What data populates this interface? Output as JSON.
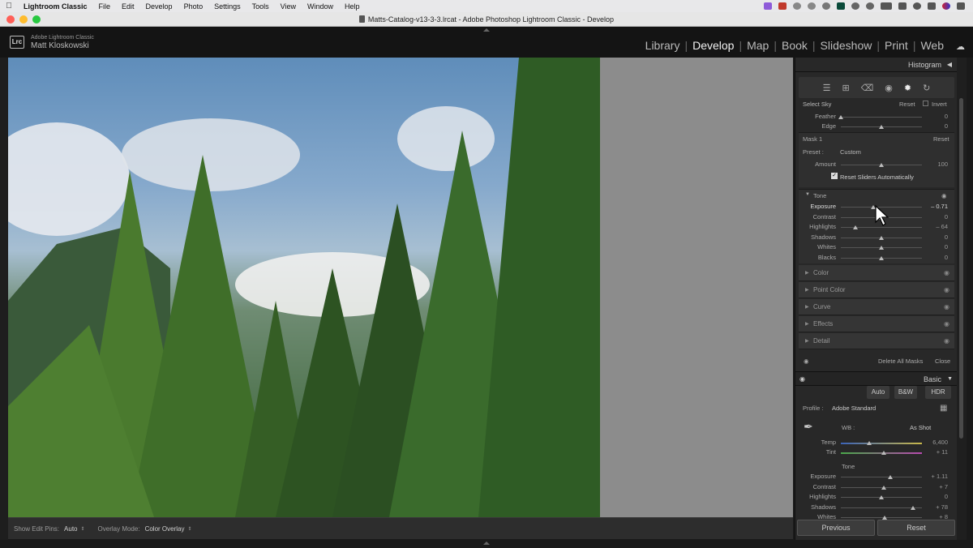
{
  "menubar": {
    "app": "Lightroom Classic",
    "items": [
      "File",
      "Edit",
      "Develop",
      "Photo",
      "Settings",
      "Tools",
      "View",
      "Window",
      "Help"
    ]
  },
  "window": {
    "title": "Matts-Catalog-v13-3-3.lrcat - Adobe Photoshop Lightroom Classic - Develop"
  },
  "identity": {
    "product": "Adobe Lightroom Classic",
    "user": "Matt Kloskowski",
    "logo": "Lrc"
  },
  "modules": [
    "Library",
    "Develop",
    "Map",
    "Book",
    "Slideshow",
    "Print",
    "Web"
  ],
  "active_module": "Develop",
  "panel": {
    "histogram_label": "Histogram",
    "mask": {
      "select_sky": "Select Sky",
      "reset": "Reset",
      "invert": "Invert",
      "feather": {
        "label": "Feather",
        "value": "0",
        "level": 0.0
      },
      "edge": {
        "label": "Edge",
        "value": "0",
        "level": 0.5
      },
      "mask_name": "Mask 1",
      "mask_reset": "Reset",
      "preset_label": "Preset :",
      "preset_value": "Custom",
      "amount": {
        "label": "Amount",
        "value": "100",
        "level": 0.5
      },
      "reset_sliders": "Reset Sliders Automatically"
    },
    "tone": {
      "heading": "Tone",
      "sliders": [
        {
          "label": "Exposure",
          "value": "– 0.71",
          "level": 0.4
        },
        {
          "label": "Contrast",
          "value": "0",
          "level": 0.5
        },
        {
          "label": "Highlights",
          "value": "– 64",
          "level": 0.18
        },
        {
          "label": "Shadows",
          "value": "0",
          "level": 0.5
        },
        {
          "label": "Whites",
          "value": "0",
          "level": 0.5
        },
        {
          "label": "Blacks",
          "value": "0",
          "level": 0.5
        }
      ]
    },
    "sections": [
      "Color",
      "Point Color",
      "Curve",
      "Effects",
      "Detail"
    ],
    "delete_all": "Delete All Masks",
    "close": "Close",
    "basic": {
      "heading": "Basic",
      "buttons": [
        "Auto",
        "B&W",
        "HDR"
      ],
      "profile_label": "Profile :",
      "profile_value": "Adobe Standard",
      "wb_label": "WB :",
      "wb_value": "As Shot",
      "temp": {
        "label": "Temp",
        "value": "6,400",
        "level": 0.35
      },
      "tint": {
        "label": "Tint",
        "value": "+ 11",
        "level": 0.53
      },
      "tone_label": "Tone",
      "sliders": [
        {
          "label": "Exposure",
          "value": "+ 1.11",
          "level": 0.61
        },
        {
          "label": "Contrast",
          "value": "+ 7",
          "level": 0.53
        },
        {
          "label": "Highlights",
          "value": "0",
          "level": 0.5
        },
        {
          "label": "Shadows",
          "value": "+ 78",
          "level": 0.89
        },
        {
          "label": "Whites",
          "value": "+ 8",
          "level": 0.54
        }
      ]
    }
  },
  "toolbar": {
    "pins_label": "Show Edit Pins:",
    "pins_value": "Auto",
    "overlay_label": "Overlay Mode:",
    "overlay_value": "Color Overlay"
  },
  "buttons": {
    "previous": "Previous",
    "reset": "Reset"
  }
}
